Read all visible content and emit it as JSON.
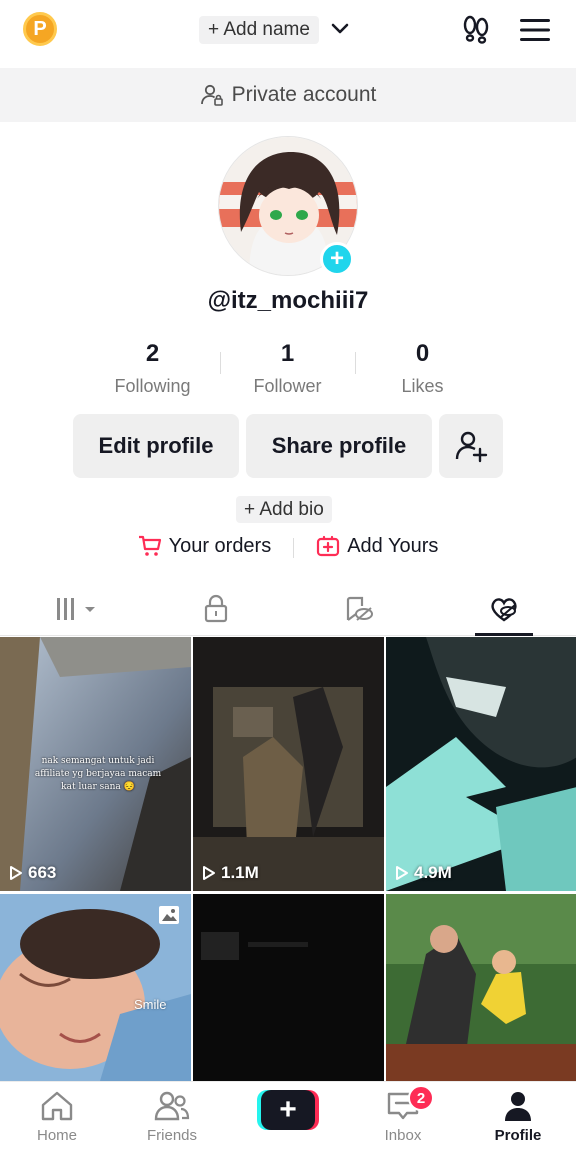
{
  "header": {
    "coin_label": "P",
    "add_name": "+ Add name"
  },
  "account": {
    "private_label": "Private account",
    "username": "@itz_mochiii7"
  },
  "stats": [
    {
      "value": "2",
      "label": "Following"
    },
    {
      "value": "1",
      "label": "Follower"
    },
    {
      "value": "0",
      "label": "Likes"
    }
  ],
  "actions": {
    "edit_profile": "Edit profile",
    "share_profile": "Share profile",
    "add_bio": "+ Add bio",
    "your_orders": "Your orders",
    "add_yours": "Add Yours"
  },
  "videos": [
    {
      "caption": "nak semangat untuk jadi affiliate yg berjayaa macam kat luar sana 😔",
      "views": "663"
    },
    {
      "views": "1.1M"
    },
    {
      "views": "4.9M"
    },
    {
      "label": "Smile",
      "badge": "photo-icon"
    },
    {},
    {}
  ],
  "nav": {
    "home": "Home",
    "friends": "Friends",
    "create": "+",
    "inbox": "Inbox",
    "inbox_badge": "2",
    "profile": "Profile"
  },
  "colors": {
    "accent_pink": "#fe2c55",
    "accent_cyan": "#20d5ec",
    "coin": "#f5a623"
  }
}
